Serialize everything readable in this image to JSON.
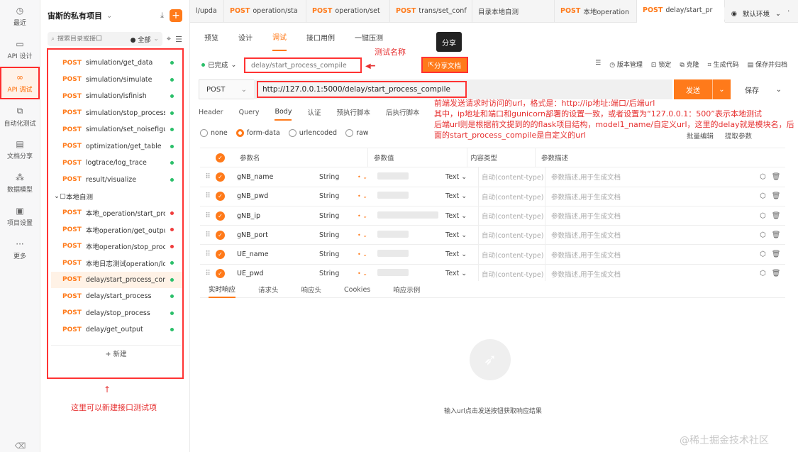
{
  "rail": {
    "items": [
      {
        "label": "最近",
        "icon": "clock-icon",
        "glyph": "◷"
      },
      {
        "label": "API 设计",
        "icon": "file-icon",
        "glyph": "▭"
      },
      {
        "label": "API 调试",
        "icon": "link-icon",
        "glyph": "∞"
      },
      {
        "label": "自动化测试",
        "icon": "flow-icon",
        "glyph": "⧉"
      },
      {
        "label": "文档分享",
        "icon": "doc-icon",
        "glyph": "▤"
      },
      {
        "label": "数据模型",
        "icon": "model-icon",
        "glyph": "⁂"
      },
      {
        "label": "项目设置",
        "icon": "folder-icon",
        "glyph": "▣"
      },
      {
        "label": "更多",
        "icon": "more-icon",
        "glyph": "···"
      }
    ],
    "active_index": 2,
    "bottom_icon": "trash-icon",
    "bottom_glyph": "⌫"
  },
  "sidebar": {
    "project_title": "宙斯的私有项目",
    "search_placeholder": "搜索目录或接口",
    "filter_label": "● 全部",
    "items": [
      {
        "method": "POST",
        "name": "simulation/get_data",
        "dot": "green"
      },
      {
        "method": "POST",
        "name": "simulation/simulate",
        "dot": "green"
      },
      {
        "method": "POST",
        "name": "simulation/isfinish",
        "dot": "green"
      },
      {
        "method": "POST",
        "name": "simulation/stop_process",
        "dot": "green"
      },
      {
        "method": "POST",
        "name": "simulation/set_noisefigure",
        "dot": "green"
      },
      {
        "method": "POST",
        "name": "optimization/get_table",
        "dot": "green"
      },
      {
        "method": "POST",
        "name": "logtrace/log_trace",
        "dot": "green"
      },
      {
        "method": "POST",
        "name": "result/visualize",
        "dot": "green"
      }
    ],
    "folder_name": "本地自测",
    "folder_items": [
      {
        "method": "POST",
        "name": "本地_operation/start_process",
        "dot": "red"
      },
      {
        "method": "POST",
        "name": "本地operation/get_output",
        "dot": "red"
      },
      {
        "method": "POST",
        "name": "本地operation/stop_process",
        "dot": "red"
      },
      {
        "method": "POST",
        "name": "本地日志测试operation/log",
        "dot": "green"
      },
      {
        "method": "POST",
        "name": "delay/start_process_compile",
        "dot": "green",
        "selected": true
      },
      {
        "method": "POST",
        "name": "delay/start_process",
        "dot": "green"
      },
      {
        "method": "POST",
        "name": "delay/stop_process",
        "dot": "green"
      },
      {
        "method": "POST",
        "name": "delay/get_output",
        "dot": "green"
      }
    ],
    "new_label": "+ 新建",
    "annotation": "这里可以新建接口测试项"
  },
  "tabs": [
    {
      "method": "",
      "name": "l/upda"
    },
    {
      "method": "POST",
      "name": "operation/sta"
    },
    {
      "method": "POST",
      "name": "operation/set"
    },
    {
      "method": "POST",
      "name": "trans/set_conf"
    },
    {
      "method": "",
      "name": "目录本地自测"
    },
    {
      "method": "POST",
      "name": "本地operation"
    },
    {
      "method": "POST",
      "name": "delay/start_pr",
      "active": true
    }
  ],
  "tab_tools": [
    "+",
    "⌄",
    "◀",
    "▶"
  ],
  "subnav": {
    "tabs": [
      "预览",
      "设计",
      "调试",
      "接口用例",
      "一键压测"
    ],
    "active": "调试",
    "env_label": "默认环境"
  },
  "request": {
    "status": "已完成",
    "name": "delay/start_process_compile",
    "share_label": "分享文档",
    "share_tooltip": "分享",
    "name_annotation": "测试名称",
    "tools": [
      "版本管理",
      "锁定",
      "克隆",
      "生成代码",
      "保存并归档"
    ],
    "method": "POST",
    "url": "http://127.0.0.1:5000/delay/start_process_compile",
    "send_label": "发送",
    "save_label": "保存",
    "url_annotation": "前端发送请求时访问的url，格式是：http://ip地址:端口/后端url\n其中，ip地址和端口和gunicorn部署的设置一致，或者设置为“127.0.0.1：500”表示本地测试\n后端url则是根据前文提到的的flask项目结构，model1_name/自定义url，这里的delay就是模块名，后面的start_process_compile是自定义的url"
  },
  "req_tabs": [
    "Header",
    "Query",
    "Body",
    "认证",
    "预执行脚本",
    "后执行脚本"
  ],
  "req_tab_active": "Body",
  "body_types": [
    "none",
    "form-data",
    "urlencoded",
    "raw"
  ],
  "body_type_active": "form-data",
  "param_tools": [
    "批量编辑",
    "提取参数"
  ],
  "params": {
    "headers": {
      "name": "参数名",
      "value": "参数值",
      "content_type": "内容类型",
      "desc": "参数描述"
    },
    "rows": [
      {
        "name": "gNB_name",
        "type": "String",
        "ctype": "Text",
        "ct_placeholder": "自动(content-type)",
        "desc": "参数描述,用于生成文档"
      },
      {
        "name": "gNB_pwd",
        "type": "String",
        "ctype": "Text",
        "ct_placeholder": "自动(content-type)",
        "desc": "参数描述,用于生成文档"
      },
      {
        "name": "gNB_ip",
        "type": "String",
        "ctype": "Text",
        "ct_placeholder": "自动(content-type)",
        "desc": "参数描述,用于生成文档"
      },
      {
        "name": "gNB_port",
        "type": "String",
        "ctype": "Text",
        "ct_placeholder": "自动(content-type)",
        "desc": "参数描述,用于生成文档"
      },
      {
        "name": "UE_name",
        "type": "String",
        "ctype": "Text",
        "ct_placeholder": "自动(content-type)",
        "desc": "参数描述,用于生成文档"
      },
      {
        "name": "UE_pwd",
        "type": "String",
        "ctype": "Text",
        "ct_placeholder": "自动(content-type)",
        "desc": "参数描述,用于生成文档"
      }
    ]
  },
  "response": {
    "tabs": [
      "实时响应",
      "请求头",
      "响应头",
      "Cookies",
      "响应示例"
    ],
    "active": "实时响应",
    "empty_text": "输入url点击发送按钮获取响应结果"
  },
  "watermark": "@稀土掘金技术社区",
  "colors": {
    "accent": "#ff7a1a",
    "annotation": "#e63030",
    "success": "#2bbf6a",
    "error": "#f03d3d"
  }
}
